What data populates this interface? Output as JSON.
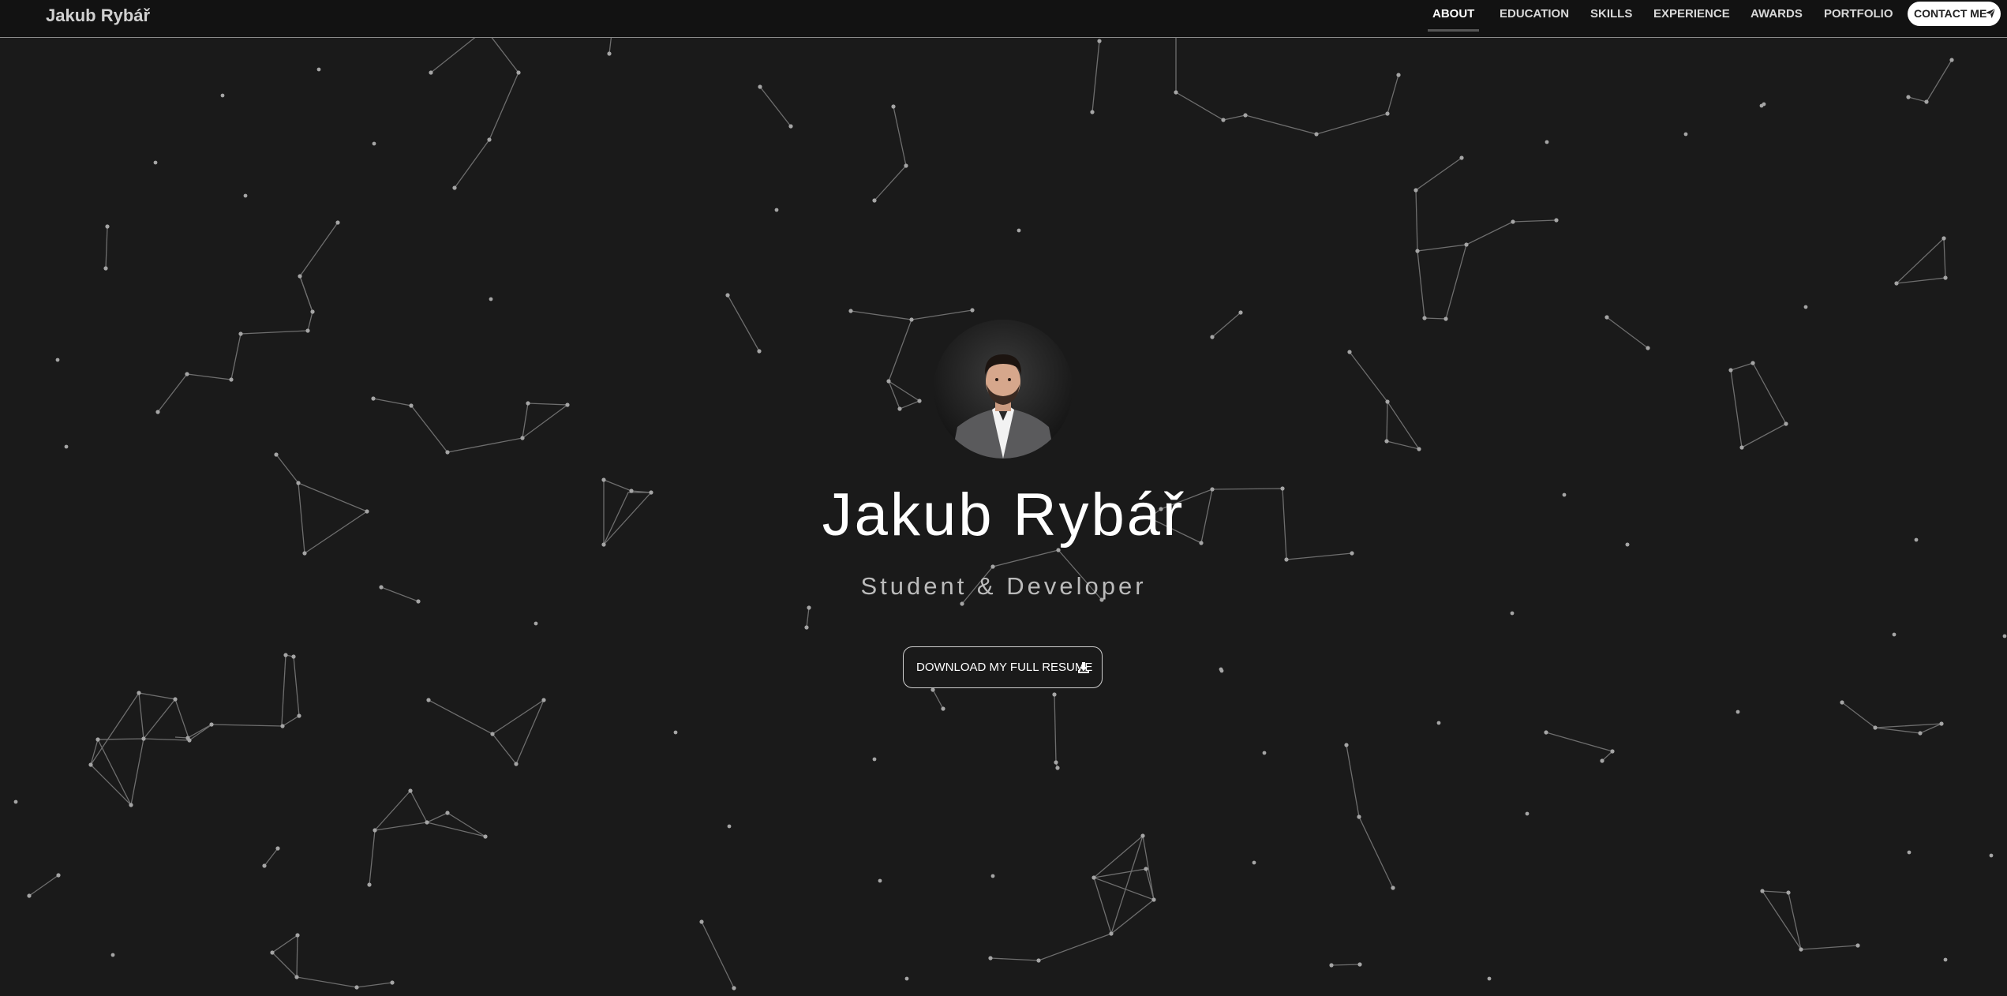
{
  "nav": {
    "brand": "Jakub Rybář",
    "items": [
      {
        "label": "ABOUT",
        "active": true
      },
      {
        "label": "EDUCATION",
        "active": false
      },
      {
        "label": "SKILLS",
        "active": false
      },
      {
        "label": "EXPERIENCE",
        "active": false
      },
      {
        "label": "AWARDS",
        "active": false
      },
      {
        "label": "PORTFOLIO",
        "active": false
      }
    ],
    "contact": {
      "label": "CONTACT ME",
      "icon": "paper-plane-icon"
    }
  },
  "hero": {
    "name": "Jakub Rybář",
    "subtitle": "Student & Developer",
    "avatar_icon": "profile-photo",
    "resume_button": {
      "label": "DOWNLOAD MY FULL RESUME",
      "icon": "download-icon"
    }
  },
  "colors": {
    "background": "#1a1a1a",
    "nav_background": "#121212",
    "particle": "#9a9a9a",
    "text_primary": "#ffffff",
    "text_secondary": "#bbbbbb"
  }
}
